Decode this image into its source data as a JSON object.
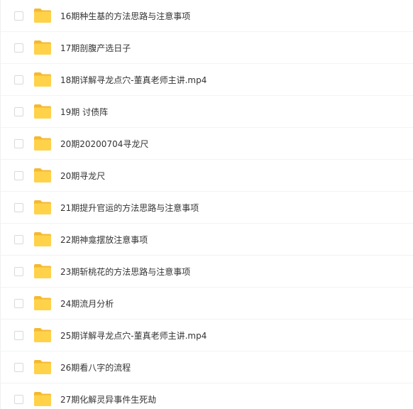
{
  "files": [
    {
      "name": "16期种生基的方法思路与注意事项",
      "icon": "folder-icon"
    },
    {
      "name": "17期剖腹产选日子",
      "icon": "folder-icon"
    },
    {
      "name": "18期详解寻龙点穴-董真老师主讲.mp4",
      "icon": "folder-icon"
    },
    {
      "name": "19期 讨债阵",
      "icon": "folder-icon"
    },
    {
      "name": "20期20200704寻龙尺",
      "icon": "folder-icon"
    },
    {
      "name": "20期寻龙尺",
      "icon": "folder-icon"
    },
    {
      "name": "21期提升官运的方法思路与注意事项",
      "icon": "folder-icon"
    },
    {
      "name": "22期神龛摆放注意事项",
      "icon": "folder-icon"
    },
    {
      "name": "23期斩桃花的方法思路与注意事项",
      "icon": "folder-icon"
    },
    {
      "name": "24期流月分析",
      "icon": "folder-icon"
    },
    {
      "name": "25期详解寻龙点穴-董真老师主讲.mp4",
      "icon": "folder-icon"
    },
    {
      "name": "26期看八字的流程",
      "icon": "folder-icon"
    },
    {
      "name": "27期化解灵异事件生死劫",
      "icon": "folder-icon"
    }
  ],
  "colors": {
    "folder_body": "#FFD24A",
    "folder_tab": "#F5B92E",
    "text": "#333333",
    "checkbox_border": "#D6D9DE",
    "row_divider": "#F2F3F5"
  }
}
